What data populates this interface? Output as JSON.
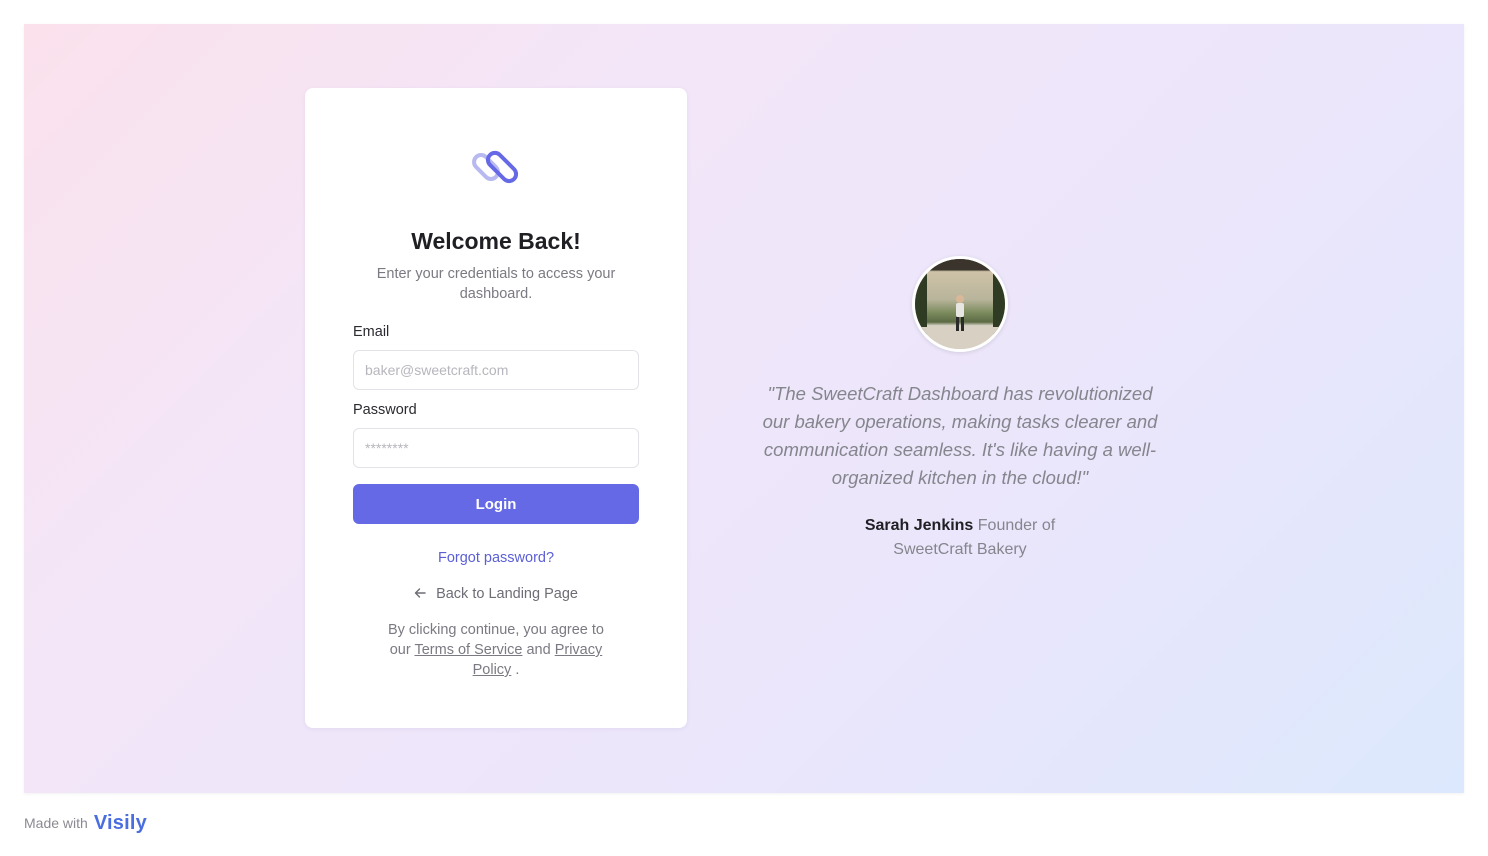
{
  "login": {
    "title": "Welcome Back!",
    "subtitle": "Enter your credentials to access your dashboard.",
    "email_label": "Email",
    "email_placeholder": "baker@sweetcraft.com",
    "password_label": "Password",
    "password_placeholder": "********",
    "login_button": "Login",
    "forgot_password": "Forgot password?",
    "back_link": "Back to Landing Page",
    "legal_prefix": "By clicking continue, you agree to our ",
    "terms_link": "Terms of Service",
    "legal_and": " and ",
    "privacy_link": "Privacy Policy",
    "legal_suffix": " ."
  },
  "testimonial": {
    "quote": "\"The SweetCraft Dashboard has revolutionized our bakery operations, making tasks clearer and communication seamless. It's like having a well-organized kitchen in the cloud!\"",
    "author_name": "Sarah Jenkins",
    "author_role": "Founder of SweetCraft Bakery"
  },
  "footer": {
    "made_with": "Made with",
    "brand": "Visily"
  },
  "colors": {
    "accent": "#6569e6",
    "link": "#5b5fd6",
    "brand": "#4a6ee0"
  },
  "icons": {
    "logo": "linked-pill-logo",
    "back": "arrow-left-icon"
  }
}
